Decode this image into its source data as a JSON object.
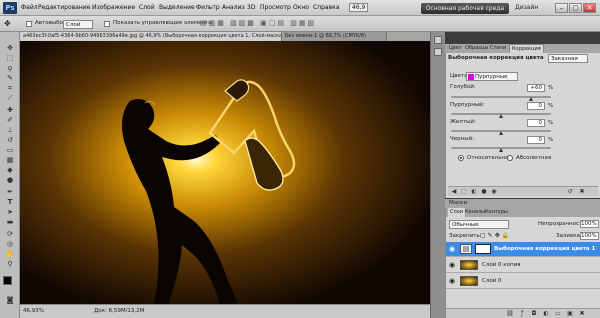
{
  "app": {
    "logo": "Ps",
    "zoom_menu": "46,9"
  },
  "menu": [
    "Файл",
    "Редактирование",
    "Изображение",
    "Слой",
    "Выделение",
    "Фильтр",
    "Анализ",
    "3D",
    "Просмотр",
    "Окно",
    "Справка"
  ],
  "workspace": {
    "active": "Основная рабочая среда",
    "other": "Дизайн"
  },
  "window_buttons": [
    "–",
    "▢",
    "✕"
  ],
  "options": {
    "auto_select": "Автовыбор:",
    "auto_select_value": "Слой",
    "show_transform": "Показать управляющие элементы"
  },
  "doc_tabs": [
    "a463ec3f-0af5-4364-9b60-94963396a49e.jpg @ 46,9% (Выборочная коррекция цвета 1, Слой-маска/8) *",
    "Без имени-1 @ 66,7% (CMYK/8)"
  ],
  "status": {
    "zoom": "46,93%",
    "doc": "Док: 6,59M/13,2M"
  },
  "adjust_panel": {
    "tabs": [
      "Цвет",
      "Образцы",
      "Стили",
      "Коррекция"
    ],
    "title": "Выборочная коррекция цвета",
    "preset": "Заказная",
    "colors_label": "Цвета:",
    "colors_value": "Пурпурные",
    "sliders": [
      {
        "label": "Голубой:",
        "value": "+60",
        "unit": "%",
        "level": 0.8
      },
      {
        "label": "Пурпурный:",
        "value": "0",
        "unit": "%",
        "level": 0.5
      },
      {
        "label": "Желтый:",
        "value": "0",
        "unit": "%",
        "level": 0.5
      },
      {
        "label": "Черный:",
        "value": "0",
        "unit": "%",
        "level": 0.5
      }
    ],
    "method_relative": "Относительная",
    "method_absolute": "Абсолютная"
  },
  "mask_panel": {
    "title": "Маски"
  },
  "layers_panel": {
    "tabs": [
      "Слои",
      "Каналы",
      "Контуры"
    ],
    "blend_mode": "Обычные",
    "opacity_label": "Непрозрачность:",
    "opacity": "100%",
    "lock_label": "Закрепить:",
    "fill_label": "Заливка:",
    "fill": "100%",
    "layers": [
      {
        "name": "Выборочная коррекция цвета 1",
        "selected": true
      },
      {
        "name": "Слой 0 копия",
        "selected": false
      },
      {
        "name": "Слой 0",
        "selected": false
      }
    ]
  },
  "colors": {
    "accent": "#3b8be8",
    "magenta": "#e000e0"
  }
}
